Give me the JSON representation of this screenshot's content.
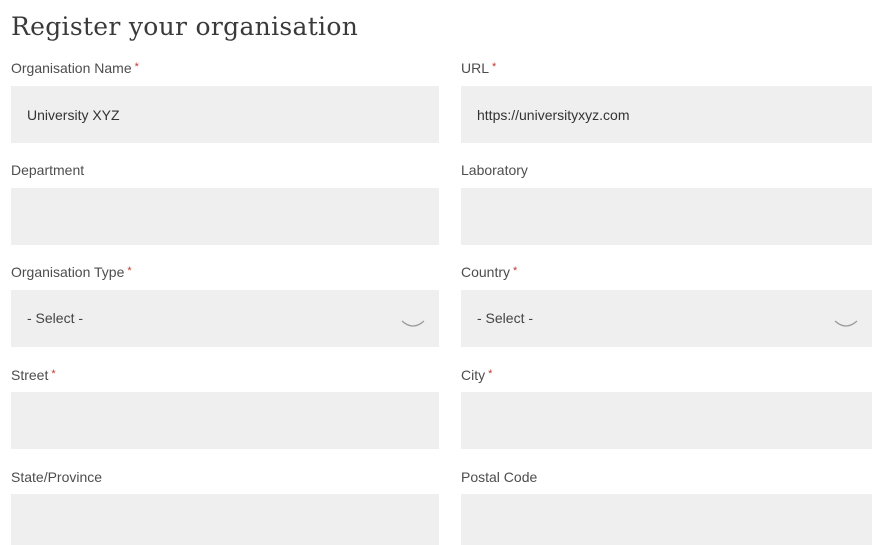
{
  "form": {
    "title": "Register your organisation",
    "required_marker": "*",
    "fields": {
      "organisation_name": {
        "label": "Organisation Name",
        "value": "University XYZ"
      },
      "url": {
        "label": "URL",
        "value": "https://universityxyz.com"
      },
      "department": {
        "label": "Department",
        "value": ""
      },
      "laboratory": {
        "label": "Laboratory",
        "value": ""
      },
      "organisation_type": {
        "label": "Organisation Type",
        "value": "- Select -"
      },
      "country": {
        "label": "Country",
        "value": "- Select -"
      },
      "street": {
        "label": "Street",
        "value": ""
      },
      "city": {
        "label": "City",
        "value": ""
      },
      "state": {
        "label": "State/Province",
        "value": ""
      },
      "postal_code": {
        "label": "Postal Code",
        "value": ""
      }
    }
  },
  "icons": {
    "dropdown": "chevron-down-icon"
  },
  "colors": {
    "field_bg": "#efefef",
    "required": "#c0392b"
  }
}
